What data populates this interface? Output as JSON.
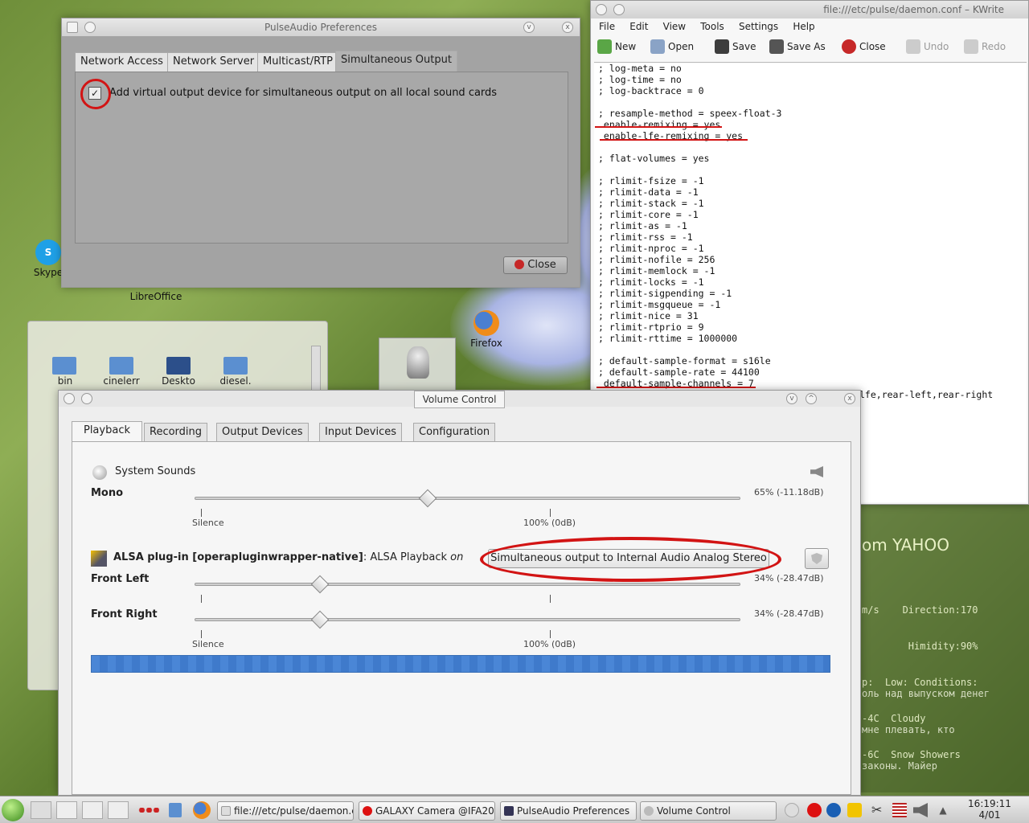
{
  "desktop": {
    "icons": [
      {
        "label": "Skype"
      },
      {
        "label": "LibreOffice"
      },
      {
        "label": "Firefox"
      }
    ],
    "folder_window": {
      "items": [
        "bin",
        "cinelerr",
        "Deskto",
        "diesel."
      ]
    },
    "weather": {
      "title": "om YAHOO",
      "lines": [
        "m/s    Direction:170",
        "        Himidity:90%",
        "p:  Low: Conditions:",
        "-4C  Cloudy",
        "-6C  Snow Showers"
      ],
      "quote": [
        "оль над выпуском денег",
        "мне плевать, кто",
        "законы. Майер"
      ]
    }
  },
  "pulse_prefs": {
    "title": "PulseAudio Preferences",
    "tabs": [
      "Network Access",
      "Network Server",
      "Multicast/RTP",
      "Simultaneous Output"
    ],
    "checkbox_label": "Add virtual output device for simultaneous output on all local sound cards",
    "close_label": "Close"
  },
  "kwrite": {
    "title": "file:///etc/pulse/daemon.conf – KWrite",
    "menus": [
      "File",
      "Edit",
      "View",
      "Tools",
      "Settings",
      "Help"
    ],
    "toolbar": {
      "new": "New",
      "open": "Open",
      "save": "Save",
      "save_as": "Save As",
      "close": "Close",
      "undo": "Undo",
      "redo": "Redo"
    },
    "lines": [
      "; log-meta = no",
      "; log-time = no",
      "; log-backtrace = 0",
      "",
      "; resample-method = speex-float-3",
      " enable-remixing = yes",
      " enable-lfe-remixing = yes",
      "",
      "; flat-volumes = yes",
      "",
      "; rlimit-fsize = -1",
      "; rlimit-data = -1",
      "; rlimit-stack = -1",
      "; rlimit-core = -1",
      "; rlimit-as = -1",
      "; rlimit-rss = -1",
      "; rlimit-nproc = -1",
      "; rlimit-nofile = 256",
      "; rlimit-memlock = -1",
      "; rlimit-locks = -1",
      "; rlimit-sigpending = -1",
      "; rlimit-msgqueue = -1",
      "; rlimit-nice = 31",
      "; rlimit-rtprio = 9",
      "; rlimit-rttime = 1000000",
      "",
      "; default-sample-format = s16le",
      "; default-sample-rate = 44100",
      " default-sample-channels = 7"
    ],
    "hidden_tail": "lfe,rear-left,rear-right"
  },
  "volume_control": {
    "title": "Volume Control",
    "tabs": [
      "Playback",
      "Recording",
      "Output Devices",
      "Input Devices",
      "Configuration"
    ],
    "system_sounds": {
      "label": "System Sounds",
      "channel": "Mono",
      "value_text": "65% (-11.18dB)",
      "value": 0.65
    },
    "scale_labels": {
      "silence": "Silence",
      "hundred": "100% (0dB)"
    },
    "stream": {
      "app": "ALSA plug-in [operapluginwrapper-native]",
      "separator": ":",
      "desc": "ALSA Playback",
      "on": "on",
      "device": "Simultaneous output to Internal Audio Analog Stereo",
      "channels": [
        {
          "name": "Front Left",
          "value_text": "34% (-28.47dB)",
          "value": 0.34
        },
        {
          "name": "Front Right",
          "value_text": "34% (-28.47dB)",
          "value": 0.34
        }
      ]
    }
  },
  "taskbar": {
    "tasks": [
      "file:///etc/pulse/daemon.co",
      "GALAXY Camera @IFA201",
      "PulseAudio Preferences",
      "Volume Control"
    ],
    "clock": {
      "time": "16:19:11",
      "date": "4/01"
    }
  }
}
